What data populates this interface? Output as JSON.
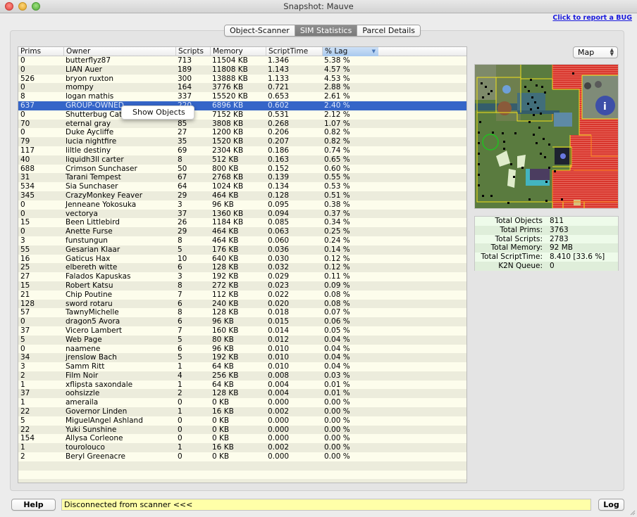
{
  "window": {
    "title": "Snapshot: Mauve",
    "bug_link": "Click to report a BUG"
  },
  "tabs": [
    {
      "label": "Object-Scanner",
      "active": false
    },
    {
      "label": "SIM Statistics",
      "active": true
    },
    {
      "label": "Parcel Details",
      "active": false
    }
  ],
  "table": {
    "columns": [
      "Prims",
      "Owner",
      "Scripts",
      "Memory",
      "ScriptTime",
      "% Lag"
    ],
    "sorted_column": "% Lag",
    "selected_row_index": 5,
    "rows": [
      [
        "0",
        "butterflyz87",
        "713",
        "11504 KB",
        "1.346",
        "5.38 %"
      ],
      [
        "0",
        "LIAN Auer",
        "189",
        "11808 KB",
        "1.143",
        "4.57 %"
      ],
      [
        "526",
        "bryon ruxton",
        "300",
        "13888 KB",
        "1.133",
        "4.53 %"
      ],
      [
        "0",
        "mompy",
        "164",
        "3776 KB",
        "0.721",
        "2.88 %"
      ],
      [
        "8",
        "logan mathis",
        "337",
        "15520 KB",
        "0.653",
        "2.61 %"
      ],
      [
        "637",
        "GROUP-OWNED",
        "220",
        "6896 KB",
        "0.602",
        "2.40 %"
      ],
      [
        "0",
        "Shutterbug Catr",
        "",
        "7152 KB",
        "0.531",
        "2.12 %"
      ],
      [
        "70",
        "eternal gray",
        "85",
        "3808 KB",
        "0.268",
        "1.07 %"
      ],
      [
        "0",
        "Duke Aycliffe",
        "27",
        "1200 KB",
        "0.206",
        "0.82 %"
      ],
      [
        "79",
        "lucia nightfire",
        "35",
        "1520 KB",
        "0.207",
        "0.82 %"
      ],
      [
        "117",
        "liltle destiny",
        "69",
        "2304 KB",
        "0.186",
        "0.74 %"
      ],
      [
        "40",
        "liquidh3ll carter",
        "8",
        "512 KB",
        "0.163",
        "0.65 %"
      ],
      [
        "688",
        "Crimson Sunchaser",
        "50",
        "800 KB",
        "0.152",
        "0.60 %"
      ],
      [
        "31",
        "Tarani Tempest",
        "67",
        "2768 KB",
        "0.139",
        "0.55 %"
      ],
      [
        "534",
        "Sia Sunchaser",
        "64",
        "1024 KB",
        "0.134",
        "0.53 %"
      ],
      [
        "345",
        "CrazyMonkey Feaver",
        "29",
        "464 KB",
        "0.128",
        "0.51 %"
      ],
      [
        "0",
        "Jenneane Yokosuka",
        "3",
        "96 KB",
        "0.095",
        "0.38 %"
      ],
      [
        "0",
        "vectorya",
        "37",
        "1360 KB",
        "0.094",
        "0.37 %"
      ],
      [
        "15",
        "Been Littlebird",
        "26",
        "1184 KB",
        "0.085",
        "0.34 %"
      ],
      [
        "0",
        "Anette Furse",
        "29",
        "464 KB",
        "0.063",
        "0.25 %"
      ],
      [
        "3",
        "funstungun",
        "8",
        "464 KB",
        "0.060",
        "0.24 %"
      ],
      [
        "55",
        "Gesarian Klaar",
        "5",
        "176 KB",
        "0.036",
        "0.14 %"
      ],
      [
        "16",
        "Gaticus Hax",
        "10",
        "640 KB",
        "0.030",
        "0.12 %"
      ],
      [
        "25",
        "elbereth witte",
        "6",
        "128 KB",
        "0.032",
        "0.12 %"
      ],
      [
        "27",
        "Falados Kapuskas",
        "3",
        "192 KB",
        "0.029",
        "0.11 %"
      ],
      [
        "15",
        "Robert Katsu",
        "8",
        "272 KB",
        "0.023",
        "0.09 %"
      ],
      [
        "21",
        "Chip Poutine",
        "7",
        "112 KB",
        "0.022",
        "0.08 %"
      ],
      [
        "128",
        "sword rotaru",
        "6",
        "240 KB",
        "0.020",
        "0.08 %"
      ],
      [
        "57",
        "TawnyMichelle",
        "8",
        "128 KB",
        "0.018",
        "0.07 %"
      ],
      [
        "0",
        "dragon5 Avora",
        "6",
        "96 KB",
        "0.015",
        "0.06 %"
      ],
      [
        "37",
        "Vicero Lambert",
        "7",
        "160 KB",
        "0.014",
        "0.05 %"
      ],
      [
        "5",
        "Web Page",
        "5",
        "80 KB",
        "0.012",
        "0.04 %"
      ],
      [
        "0",
        "naamene",
        "6",
        "96 KB",
        "0.010",
        "0.04 %"
      ],
      [
        "34",
        "jrenslow Bach",
        "5",
        "192 KB",
        "0.010",
        "0.04 %"
      ],
      [
        "3",
        "Samm Ritt",
        "1",
        "64 KB",
        "0.010",
        "0.04 %"
      ],
      [
        "2",
        "Film Noir",
        "4",
        "256 KB",
        "0.008",
        "0.03 %"
      ],
      [
        "1",
        "xflipsta saxondale",
        "1",
        "64 KB",
        "0.004",
        "0.01 %"
      ],
      [
        "37",
        "oohsizzle",
        "2",
        "128 KB",
        "0.004",
        "0.01 %"
      ],
      [
        "1",
        "ameraila",
        "0",
        "0 KB",
        "0.000",
        "0.00 %"
      ],
      [
        "22",
        "Governor Linden",
        "1",
        "16 KB",
        "0.002",
        "0.00 %"
      ],
      [
        "5",
        "MiguelAngel Ashland",
        "0",
        "0 KB",
        "0.000",
        "0.00 %"
      ],
      [
        "22",
        "Yuki Sunshine",
        "0",
        "0 KB",
        "0.000",
        "0.00 %"
      ],
      [
        "154",
        "Allysa Corleone",
        "0",
        "0 KB",
        "0.000",
        "0.00 %"
      ],
      [
        "1",
        "tourolouco",
        "1",
        "16 KB",
        "0.002",
        "0.00 %"
      ],
      [
        "2",
        "Beryl Greenacre",
        "0",
        "0 KB",
        "0.000",
        "0.00 %"
      ]
    ]
  },
  "context_menu": {
    "items": [
      "Show Objects"
    ]
  },
  "view_select": {
    "value": "Map"
  },
  "stats": [
    {
      "label": "Total Objects",
      "value": "811"
    },
    {
      "label": "Total Prims:",
      "value": "3763"
    },
    {
      "label": "Total Scripts:",
      "value": "2783"
    },
    {
      "label": "Total Memory:",
      "value": "92 MB"
    },
    {
      "label": "Total ScriptTime:",
      "value": "8.410 [33.6 %]"
    },
    {
      "label": "K2N Queue:",
      "value": "0"
    }
  ],
  "footer": {
    "help_label": "Help",
    "status_text": "Disconnected from scanner <<<",
    "log_label": "Log"
  },
  "colors": {
    "selection": "#3565c8",
    "status_bg": "#ffffa8",
    "parcel_border": "#f2e21b",
    "restricted_parcel": "#d93a30"
  }
}
